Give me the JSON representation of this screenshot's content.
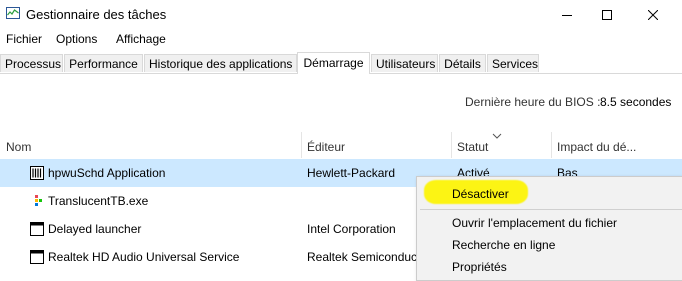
{
  "window": {
    "title": "Gestionnaire des tâches",
    "controls": [
      "minimize-icon",
      "maximize-icon",
      "close-icon"
    ]
  },
  "menu": [
    "Fichier",
    "Options",
    "Affichage"
  ],
  "tabs": [
    {
      "label": "Processus",
      "active": false
    },
    {
      "label": "Performance",
      "active": false
    },
    {
      "label": "Historique des applications",
      "active": false
    },
    {
      "label": "Démarrage",
      "active": true
    },
    {
      "label": "Utilisateurs",
      "active": false
    },
    {
      "label": "Détails",
      "active": false
    },
    {
      "label": "Services",
      "active": false
    }
  ],
  "bios": {
    "label": "Dernière heure du BIOS :",
    "value": "8.5 secondes"
  },
  "columns": [
    "Nom",
    "Éditeur",
    "Statut",
    "Impact du dé..."
  ],
  "rows": [
    {
      "name": "hpwuSchd Application",
      "publisher": "Hewlett-Packard",
      "status": "Activé",
      "impact": "Bas",
      "icon": "hp-app-icon",
      "selected": true
    },
    {
      "name": "TranslucentTB.exe",
      "publisher": "",
      "status": "",
      "impact": "",
      "icon": "translucenttb-icon",
      "selected": false
    },
    {
      "name": "Delayed launcher",
      "publisher": "Intel Corporation",
      "status": "",
      "impact": "",
      "icon": "intel-app-icon",
      "selected": false
    },
    {
      "name": "Realtek HD Audio Universal Service",
      "publisher": "Realtek Semiconduct",
      "status": "",
      "impact": "",
      "icon": "realtek-app-icon",
      "selected": false
    }
  ],
  "context_menu": {
    "items": [
      "Désactiver",
      "Ouvrir l'emplacement du fichier",
      "Recherche en ligne",
      "Propriétés"
    ],
    "highlight_color": "#fcf414"
  },
  "colors": {
    "selection": "#cce8ff",
    "accent_highlight": "#fcf414"
  }
}
